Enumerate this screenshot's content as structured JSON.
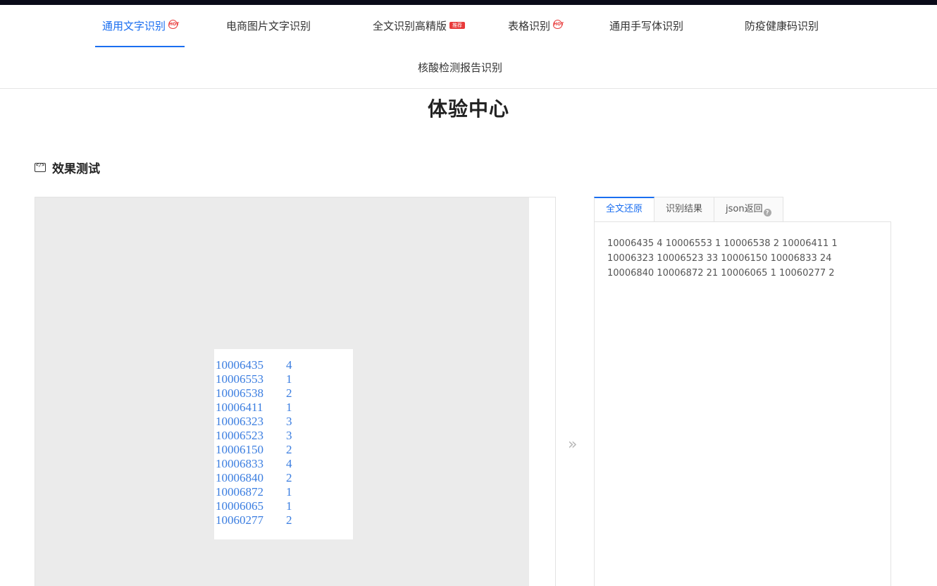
{
  "nav": {
    "row1": [
      {
        "label": "通用文字识别",
        "badge": "hot"
      },
      {
        "label": "电商图片文字识别",
        "badge": ""
      },
      {
        "label": "全文识别高精版",
        "badge": "recommend",
        "badge_text": "推荐"
      },
      {
        "label": "表格识别",
        "badge": "hot"
      },
      {
        "label": "通用手写体识别",
        "badge": ""
      },
      {
        "label": "防疫健康码识别",
        "badge": ""
      }
    ],
    "row2": [
      {
        "label": "核酸检测报告识别",
        "badge": ""
      }
    ],
    "active_index": 0,
    "hot_text": "HOT"
  },
  "page_title": "体验中心",
  "section": {
    "icon": "code-icon",
    "label": "效果测试"
  },
  "sample_image": {
    "rows": [
      {
        "num": "10006435",
        "cnt": "4"
      },
      {
        "num": "10006553",
        "cnt": "1"
      },
      {
        "num": "10006538",
        "cnt": "2"
      },
      {
        "num": "10006411",
        "cnt": "1"
      },
      {
        "num": "10006323",
        "cnt": "3"
      },
      {
        "num": "10006523",
        "cnt": "3"
      },
      {
        "num": "10006150",
        "cnt": "2"
      },
      {
        "num": "10006833",
        "cnt": "4"
      },
      {
        "num": "10006840",
        "cnt": "2"
      },
      {
        "num": "10006872",
        "cnt": "1"
      },
      {
        "num": "10006065",
        "cnt": "1"
      },
      {
        "num": "10060277",
        "cnt": "2"
      }
    ]
  },
  "arrow_icon": "double-chevron-right-icon",
  "result": {
    "tabs": [
      "全文还原",
      "识别结果",
      "json返回"
    ],
    "active_tab": 0,
    "help_icon": "question-icon",
    "text": "10006435 4 10006553 1 10006538 2 10006411 1 10006323 10006523 33 10006150 10006833 24 10006840 10006872 21 10006065 1 10060277 2"
  },
  "colors": {
    "accent": "#1a6ef0",
    "hot": "#e83a3a",
    "topbar": "#0a0b19",
    "image_bg": "#ebebeb"
  }
}
